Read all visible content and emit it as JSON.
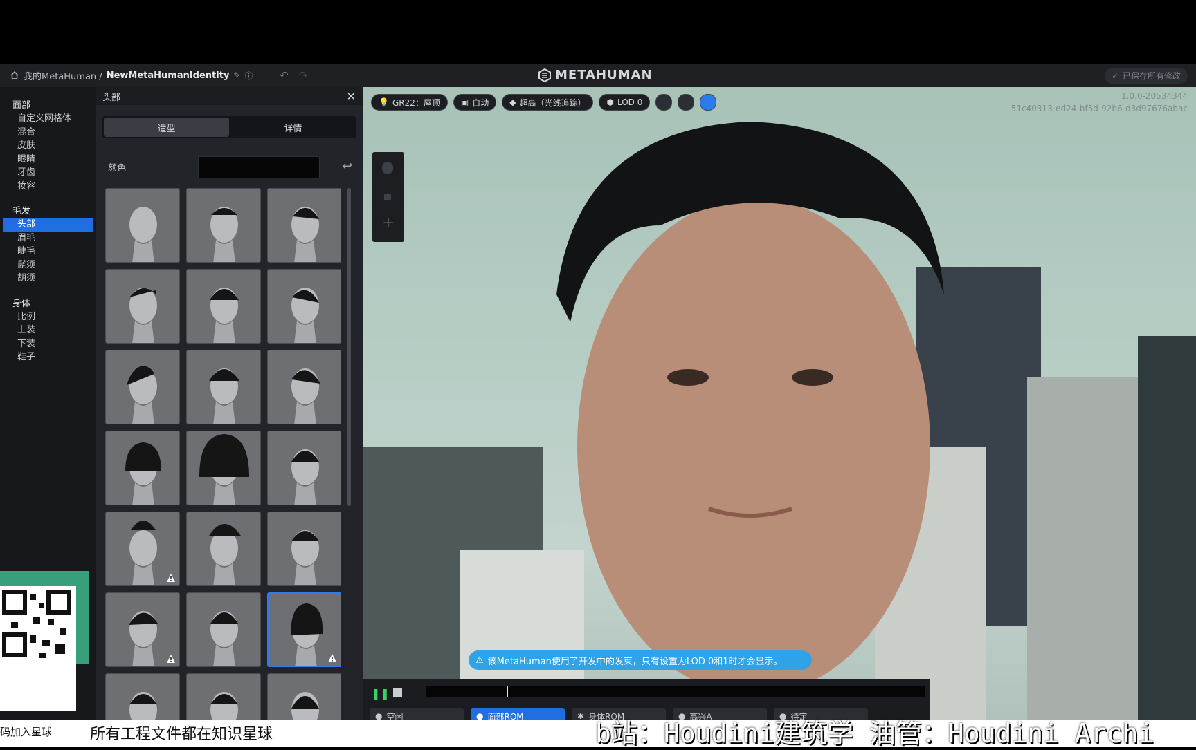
{
  "topbar": {
    "breadcrumb_root": "我的MetaHuman /",
    "breadcrumb_current": "NewMetaHumanIdentity",
    "logo": "METAHUMAN",
    "saved": "已保存所有修改"
  },
  "sidebar": {
    "sections": [
      {
        "title": "面部",
        "items": [
          "自定义网格体",
          "混合",
          "皮肤",
          "眼睛",
          "牙齿",
          "妆容"
        ]
      },
      {
        "title": "毛发",
        "items": [
          "头部",
          "眉毛",
          "睫毛",
          "髭须",
          "胡须"
        ]
      },
      {
        "title": "身体",
        "items": [
          "比例",
          "上装",
          "下装",
          "鞋子"
        ]
      }
    ],
    "selected": "头部"
  },
  "panel": {
    "title": "头部",
    "tabs": [
      "造型",
      "详情"
    ],
    "active_tab": "造型",
    "color_label": "颜色",
    "color_value": "#060606",
    "hair_tiles": 21,
    "selected_tile": 17,
    "warning_tiles": [
      12,
      15,
      17
    ]
  },
  "viewport": {
    "chips": [
      "GR22：屋顶",
      "自动",
      "超高（光线追踪）",
      "LOD 0"
    ],
    "version": "1.0.0-20534344",
    "guid": "51c40313-ed24-bf5d-92b6-d3d97676abac",
    "notice": "该MetaHuman使用了开发中的发束，只有设置为LOD 0和1时才会显示。",
    "animations": [
      "空闲",
      "面部ROM",
      "身体ROM",
      "高兴A",
      "待定"
    ],
    "active_animation": "面部ROM"
  },
  "overlay": {
    "qr_label": "码加入星球",
    "caption_left": "所有工程文件都在知识星球",
    "caption_right": "b站：Houdini建筑学  油管：Houdini Archi"
  }
}
